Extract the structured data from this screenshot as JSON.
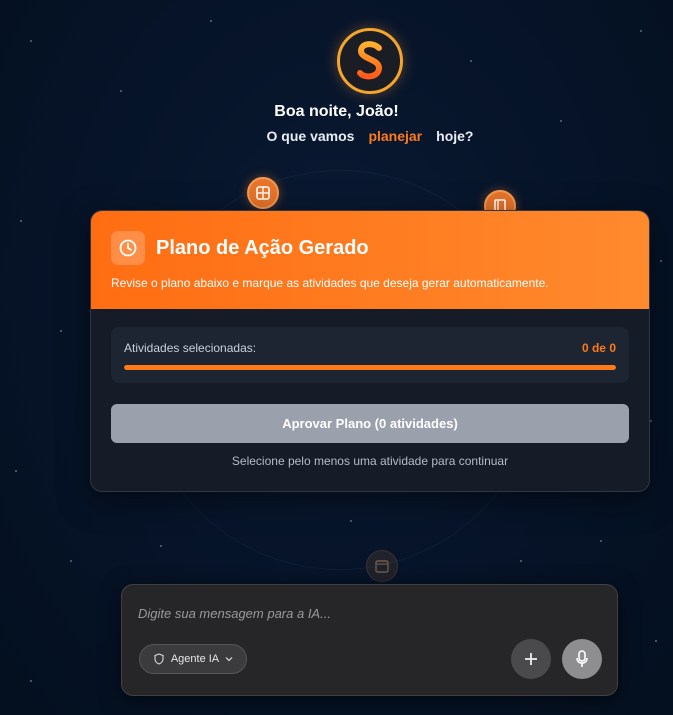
{
  "header": {
    "greeting": "Boa noite, João!",
    "question_prefix": "O que vamos",
    "question_highlight": "planejar",
    "question_suffix": "hoje?"
  },
  "plan_card": {
    "title": "Plano de Ação Gerado",
    "description": "Revise o plano abaixo e marque as atividades que deseja gerar automaticamente.",
    "selected_label": "Atividades selecionadas:",
    "selected_count": "0 de 0",
    "approve_button": "Aprovar Plano (0 atividades)",
    "hint": "Selecione pelo menos uma atividade para continuar"
  },
  "composer": {
    "placeholder": "Digite sua mensagem para a IA...",
    "agent_label": "Agente IA",
    "add_icon": "plus-icon",
    "mic_icon": "microphone-icon"
  },
  "colors": {
    "accent": "#ff7a1a",
    "background": "#061328",
    "card": "#151b27",
    "button_disabled": "#9aa1ad"
  }
}
